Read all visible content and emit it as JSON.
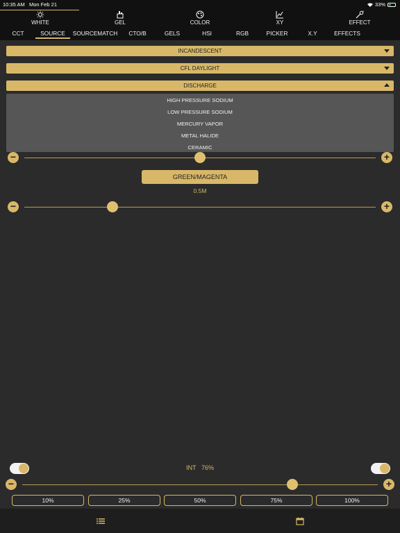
{
  "status_bar": {
    "time": "10:35 AM",
    "date": "Mon Feb 21",
    "battery_text": "33%",
    "battery_level": 0.33
  },
  "categories": [
    {
      "label": "WHITE",
      "icon": "sun-icon"
    },
    {
      "label": "GEL",
      "icon": "gel-icon"
    },
    {
      "label": "COLOR",
      "icon": "color-wheel-icon"
    },
    {
      "label": "XY",
      "icon": "xy-chart-icon"
    },
    {
      "label": "EFFECT",
      "icon": "magic-wand-icon"
    }
  ],
  "tabs": [
    "CCT",
    "SOURCE",
    "SOURCEMATCH",
    "CTO/B",
    "GELS",
    "HSI",
    "RGB",
    "PICKER",
    "X.Y",
    "EFFECTS"
  ],
  "active_tab": "SOURCE",
  "dropdowns": {
    "incandescent": "INCANDESCENT",
    "cfl": "CFL DAYLIGHT",
    "discharge": "DISCHARGE"
  },
  "discharge_menu": [
    "HIGH PRESSURE SODIUM",
    "LOW PRESSURE SODIUM",
    "MERCURY VAPOR",
    "METAL HALIDE",
    "CERAMIC"
  ],
  "source_slider": {
    "level": 0.5
  },
  "green_magenta": {
    "label": "GREEN/MAGENTA",
    "value": "0.5M",
    "level": 0.25
  },
  "intensity": {
    "label": "INT",
    "value": "76%",
    "level": 0.76
  },
  "presets": [
    "10%",
    "25%",
    "50%",
    "75%",
    "100%"
  ],
  "colors": {
    "accent": "#d8b868",
    "background": "#2b2b2b"
  }
}
